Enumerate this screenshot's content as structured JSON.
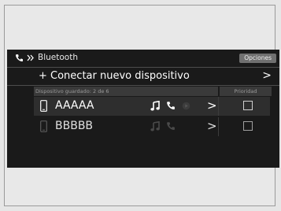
{
  "screen": {
    "title": "Bluetooth",
    "options_label": "Opciones",
    "connect_label": "+ Conectar nuevo dispositivo",
    "connect_chevron": ">",
    "saved_header": "Dispositivo guardado: 2 de 6",
    "priority_header": "Prioridad"
  },
  "devices": [
    {
      "name": "AAAAA",
      "chevron": ">"
    },
    {
      "name": "BBBBB",
      "chevron": ">"
    }
  ],
  "icons": {
    "title": [
      "phone-icon",
      "double-chevron-icon"
    ],
    "device_row": [
      "smartphone-icon",
      "music-note-icon",
      "phone-call-icon",
      "media-play-icon",
      "chevron-right-icon"
    ]
  },
  "colors": {
    "screen_background": "#1a1a1a",
    "selected_row": "#2e2e2e",
    "options_button": "#707070",
    "dim_icon": "#5a5a5a"
  }
}
